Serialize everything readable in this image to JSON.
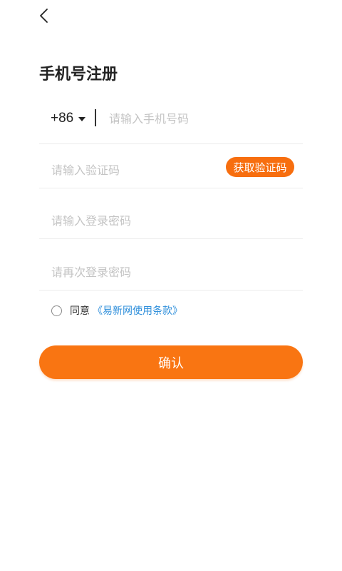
{
  "header": {
    "back_icon": "chevron-left-icon",
    "title": "手机号注册"
  },
  "phone": {
    "country_code": "+86",
    "placeholder": "请输入手机号码",
    "value": ""
  },
  "verification": {
    "placeholder": "请输入验证码",
    "value": "",
    "get_code_label": "获取验证码"
  },
  "password": {
    "placeholder": "请输入登录密码",
    "value": ""
  },
  "confirm_password": {
    "placeholder": "请再次登录密码",
    "value": ""
  },
  "agreement": {
    "checked": false,
    "label": "同意",
    "terms_link": "《易新网使用条款》"
  },
  "confirm_button": {
    "label": "确认"
  },
  "colors": {
    "accent": "#f97512",
    "link": "#2f8fdb",
    "placeholder": "#c4c4c4"
  }
}
